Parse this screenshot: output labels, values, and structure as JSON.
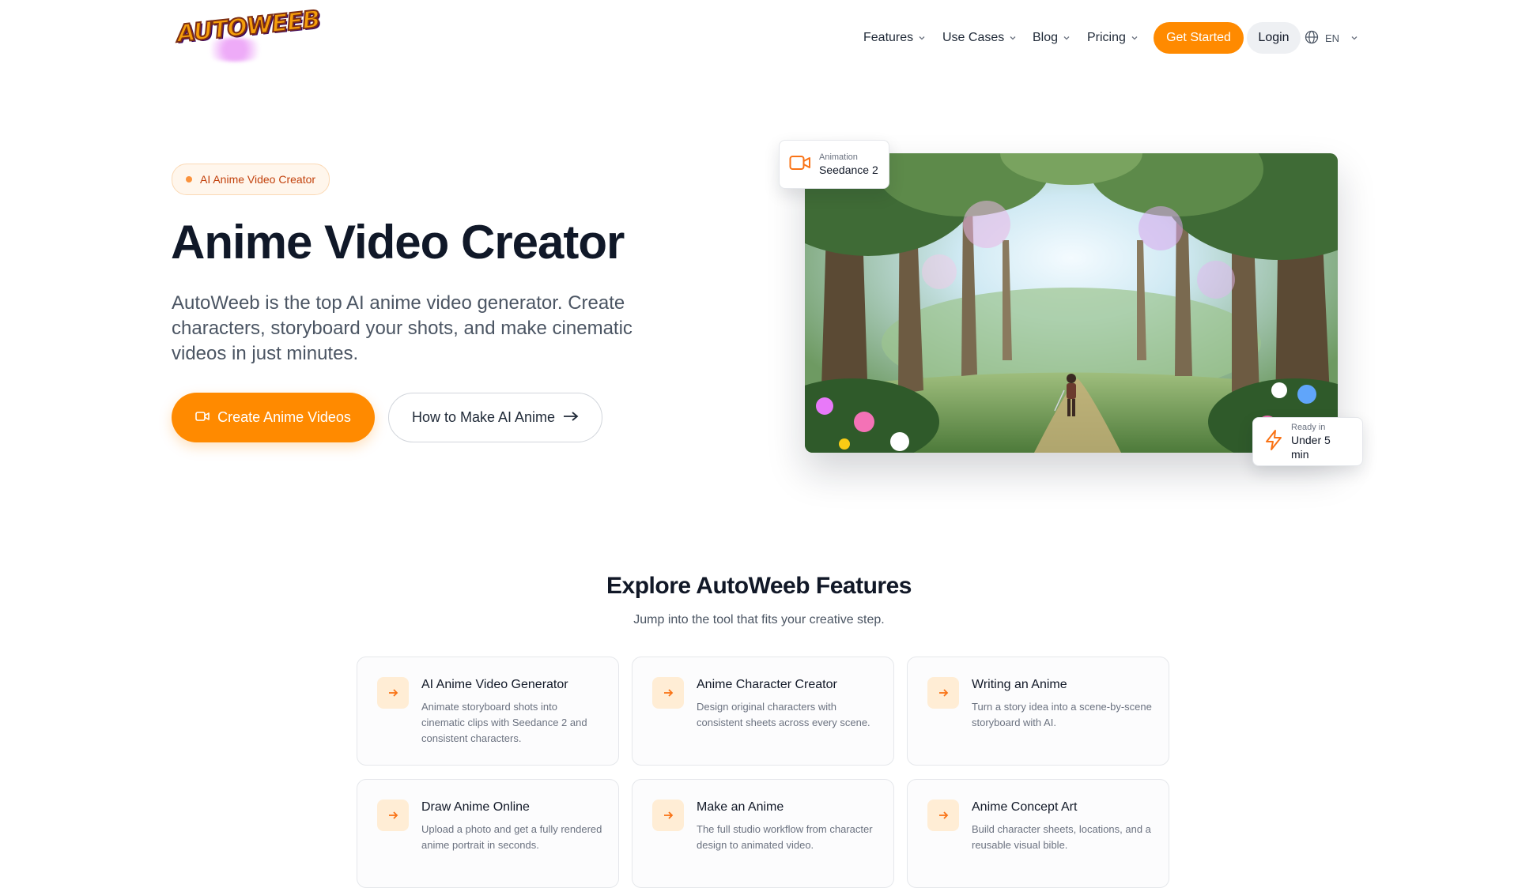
{
  "brand": {
    "logo_text": "AUTOWEEB"
  },
  "nav": {
    "items": [
      {
        "label": "Features"
      },
      {
        "label": "Use Cases"
      },
      {
        "label": "Blog"
      },
      {
        "label": "Pricing"
      }
    ],
    "get_started": "Get Started",
    "login": "Login",
    "language": "EN"
  },
  "hero": {
    "badge": "AI Anime Video Creator",
    "title": "Anime Video Creator",
    "description": "AutoWeeb is the top AI anime video generator. Create characters, storyboard your shots, and make cinematic videos in just minutes.",
    "cta_primary": "Create Anime Videos",
    "cta_secondary": "How to Make AI Anime",
    "animation_card": {
      "label": "Animation",
      "value": "Seedance 2"
    },
    "ready_card": {
      "label": "Ready in",
      "value": "Under 5 min"
    }
  },
  "features": {
    "title": "Explore AutoWeeb Features",
    "subtitle": "Jump into the tool that fits your creative step.",
    "cards": [
      {
        "title": "AI Anime Video Generator",
        "description": "Animate storyboard shots into cinematic clips with Seedance 2 and consistent characters."
      },
      {
        "title": "Anime Character Creator",
        "description": "Design original characters with consistent sheets across every scene."
      },
      {
        "title": "Writing an Anime",
        "description": "Turn a story idea into a scene-by-scene storyboard with AI."
      },
      {
        "title": "Draw Anime Online",
        "description": "Upload a photo and get a fully rendered anime portrait in seconds."
      },
      {
        "title": "Make an Anime",
        "description": "The full studio workflow from character design to animated video."
      },
      {
        "title": "Anime Concept Art",
        "description": "Build character sheets, locations, and a reusable visual bible."
      }
    ]
  },
  "colors": {
    "accent": "#ff8a00",
    "badge_text": "#c2410c",
    "icon_bg": "#ffedd5"
  }
}
